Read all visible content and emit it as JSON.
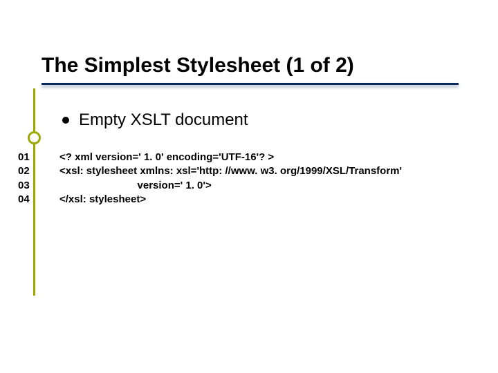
{
  "title": "The Simplest Stylesheet (1 of 2)",
  "bullet": "Empty XSLT document",
  "code": {
    "lines": [
      {
        "n": "01",
        "text": "<? xml version=' 1. 0' encoding='UTF-16'? >"
      },
      {
        "n": "02",
        "text": "<xsl: stylesheet xmlns: xsl='http: //www. w3. org/1999/XSL/Transform'"
      },
      {
        "n": "03",
        "text": "                           version=' 1. 0'>"
      },
      {
        "n": "04",
        "text": "</xsl: stylesheet>"
      }
    ]
  }
}
